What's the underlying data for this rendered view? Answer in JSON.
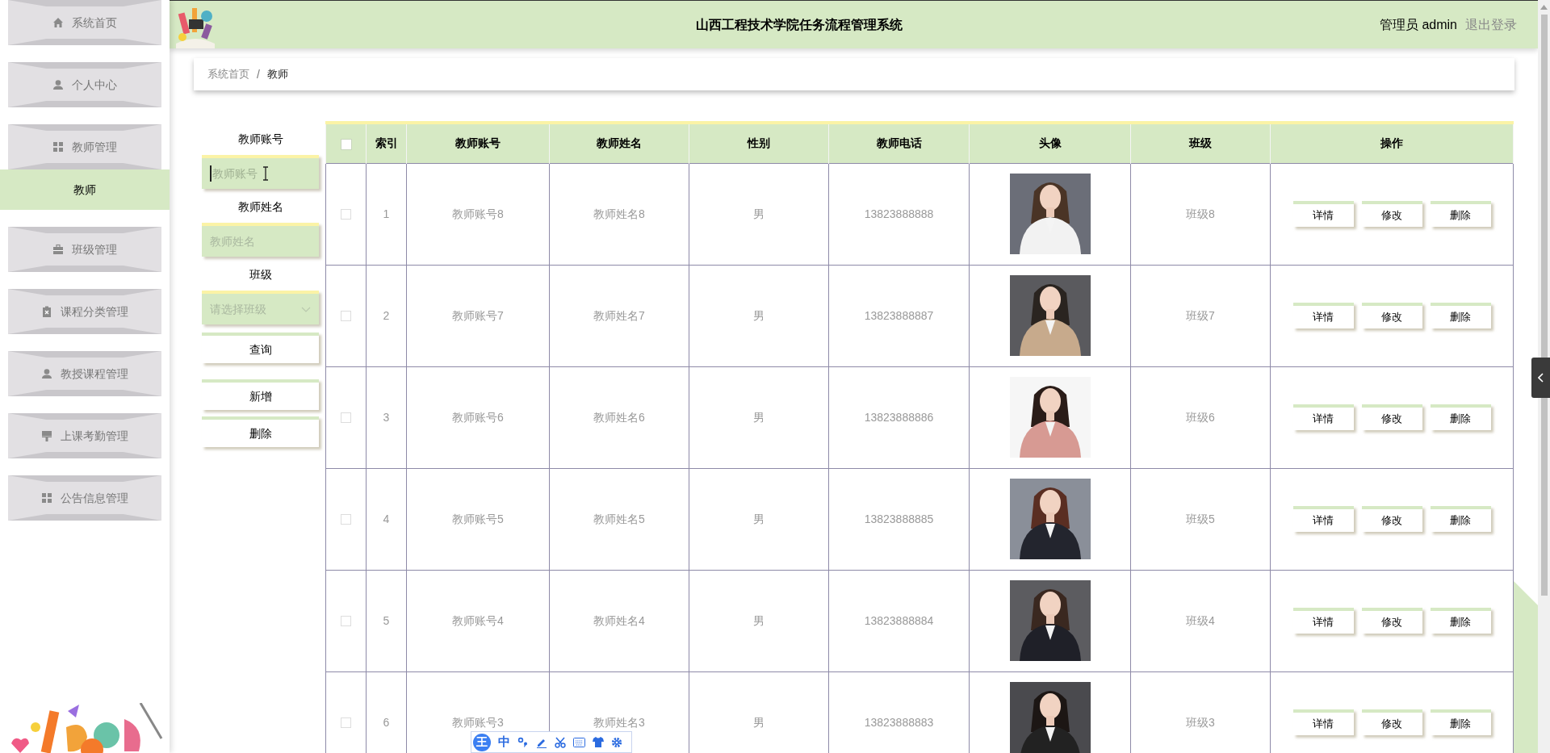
{
  "header": {
    "title": "山西工程技术学院任务流程管理系统",
    "user_label": "管理员 admin",
    "logout": "退出登录"
  },
  "sidebar": {
    "items": [
      {
        "label": "系统首页",
        "selected": false
      },
      {
        "label": "个人中心",
        "selected": false
      },
      {
        "label": "教师管理",
        "selected": false,
        "children": [
          {
            "label": "教师",
            "selected": true
          }
        ]
      },
      {
        "label": "班级管理",
        "selected": false
      },
      {
        "label": "课程分类管理",
        "selected": false
      },
      {
        "label": "教授课程管理",
        "selected": false
      },
      {
        "label": "上课考勤管理",
        "selected": false
      },
      {
        "label": "公告信息管理",
        "selected": false
      }
    ]
  },
  "breadcrumb": [
    "系统首页",
    "教师"
  ],
  "breadcrumb_separator": "/",
  "filters": [
    {
      "kind": "input",
      "label": "教师账号",
      "placeholder": "教师账号",
      "focused": true
    },
    {
      "kind": "input",
      "label": "教师姓名",
      "placeholder": "教师姓名",
      "focused": false
    },
    {
      "kind": "select",
      "label": "班级",
      "placeholder": "请选择班级",
      "focused": false
    }
  ],
  "buttons": [
    "查询",
    "新增",
    "删除"
  ],
  "table": {
    "select_all_checked": false,
    "columns": [
      "索引",
      "教师账号",
      "教师姓名",
      "性别",
      "教师电话",
      "头像",
      "班级",
      "操作"
    ],
    "rows": [
      {
        "checked": false,
        "index": "1",
        "account": "教师账号8",
        "name": "教师姓名8",
        "gender": "男",
        "phone": "13823888888",
        "class": "班级8",
        "actions": [
          "详情",
          "修改",
          "删除"
        ]
      },
      {
        "checked": false,
        "index": "2",
        "account": "教师账号7",
        "name": "教师姓名7",
        "gender": "男",
        "phone": "13823888887",
        "class": "班级7",
        "actions": [
          "详情",
          "修改",
          "删除"
        ]
      },
      {
        "checked": false,
        "index": "3",
        "account": "教师账号6",
        "name": "教师姓名6",
        "gender": "男",
        "phone": "13823888886",
        "class": "班级6",
        "actions": [
          "详情",
          "修改",
          "删除"
        ]
      },
      {
        "checked": false,
        "index": "4",
        "account": "教师账号5",
        "name": "教师姓名5",
        "gender": "男",
        "phone": "13823888885",
        "class": "班级5",
        "actions": [
          "详情",
          "修改",
          "删除"
        ]
      },
      {
        "checked": false,
        "index": "5",
        "account": "教师账号4",
        "name": "教师姓名4",
        "gender": "男",
        "phone": "13823888884",
        "class": "班级4",
        "actions": [
          "详情",
          "修改",
          "删除"
        ]
      },
      {
        "checked": false,
        "index": "6",
        "account": "教师账号3",
        "name": "教师姓名3",
        "gender": "男",
        "phone": "13823888883",
        "class": "班级3",
        "actions": [
          "详情",
          "修改",
          "删除"
        ]
      }
    ]
  },
  "ime_toolbar": {
    "logo": "王",
    "mode": "中"
  }
}
